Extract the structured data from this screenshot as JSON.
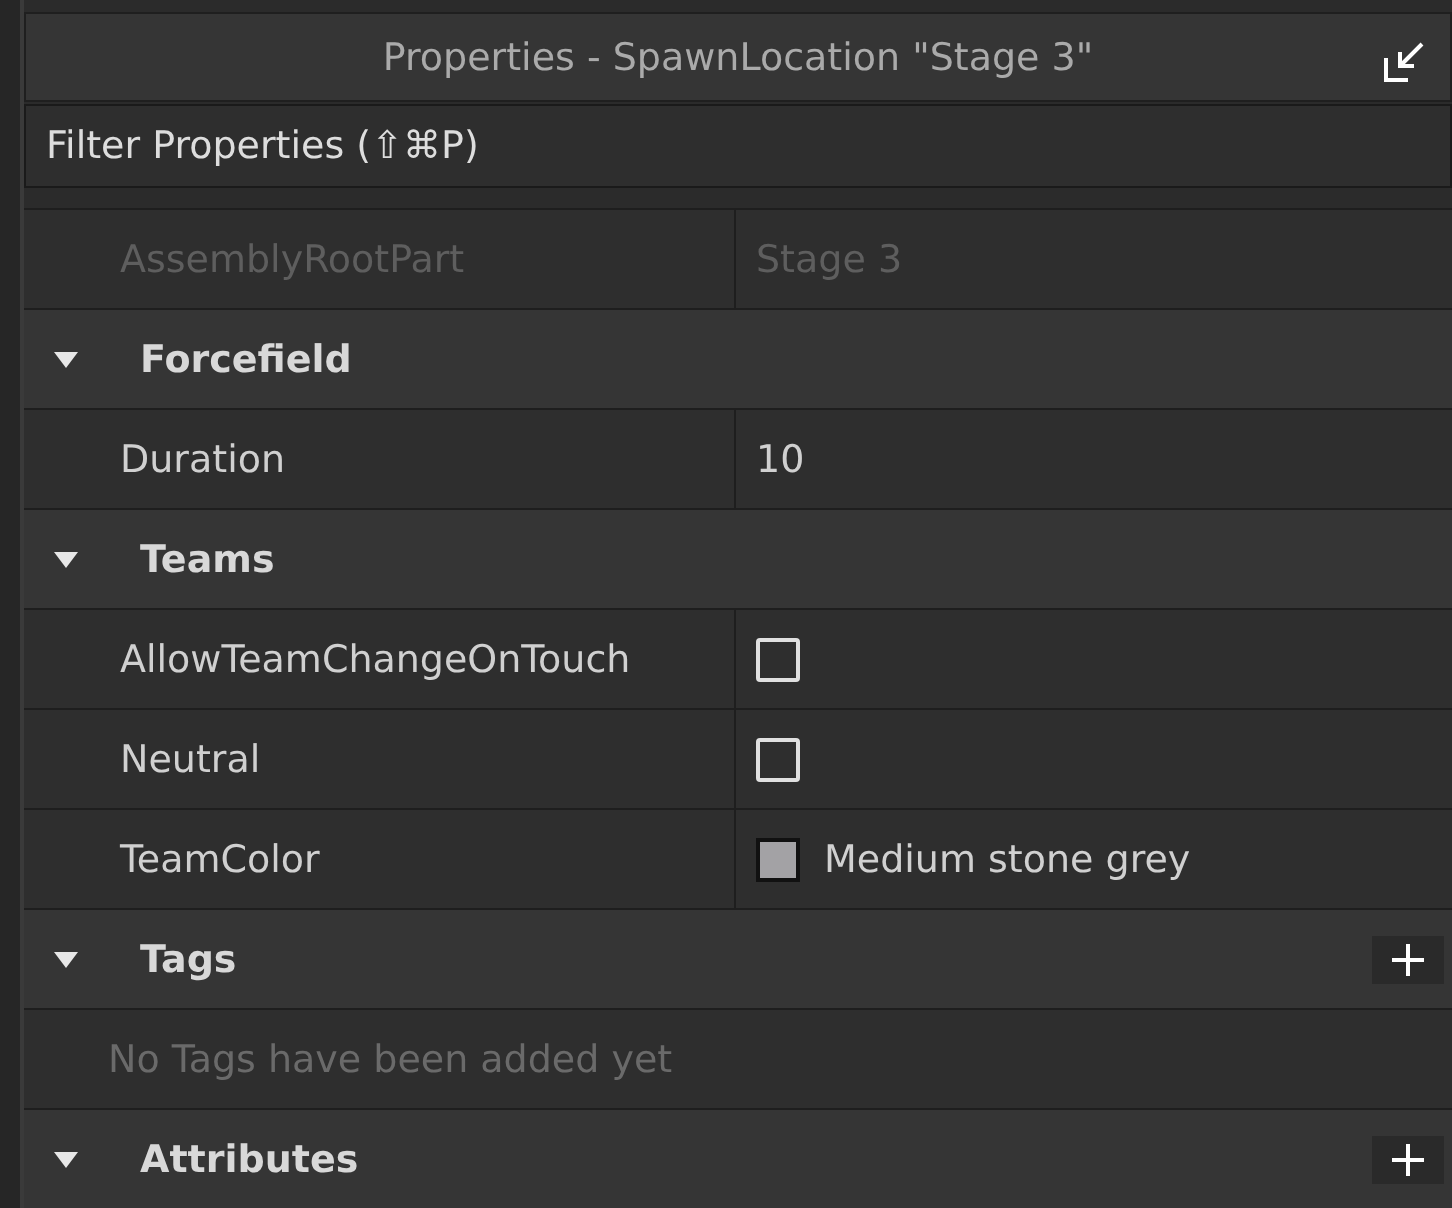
{
  "window": {
    "title": "Properties - SpawnLocation \"Stage 3\""
  },
  "filter": {
    "placeholder": "Filter Properties (⇧⌘P)"
  },
  "rows": [
    {
      "kind": "property",
      "name": "AssemblyRootPart",
      "value": "Stage 3",
      "disabled": true
    },
    {
      "kind": "section",
      "title": "Forcefield",
      "expanded": true
    },
    {
      "kind": "property",
      "name": "Duration",
      "value": "10",
      "disabled": false
    },
    {
      "kind": "section",
      "title": "Teams",
      "expanded": true
    },
    {
      "kind": "checkbox",
      "name": "AllowTeamChangeOnTouch",
      "checked": false
    },
    {
      "kind": "checkbox",
      "name": "Neutral",
      "checked": false
    },
    {
      "kind": "color",
      "name": "TeamColor",
      "value": "Medium stone grey",
      "color": "#a3a2a5"
    },
    {
      "kind": "section",
      "title": "Tags",
      "expanded": true,
      "addable": true
    },
    {
      "kind": "message",
      "text": "No Tags have been added yet"
    },
    {
      "kind": "section",
      "title": "Attributes",
      "expanded": true,
      "addable": true
    }
  ]
}
